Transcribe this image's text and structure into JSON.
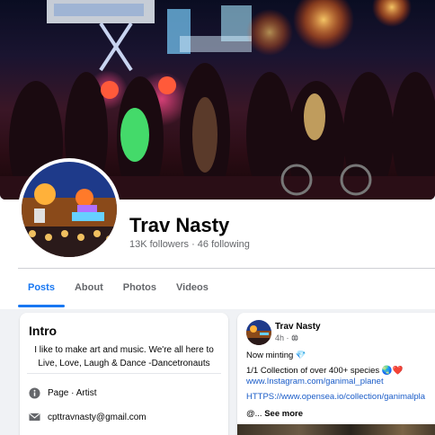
{
  "profile": {
    "name": "Trav Nasty",
    "stats": "13K followers · 46 following"
  },
  "tabs": [
    {
      "label": "Posts",
      "active": true
    },
    {
      "label": "About",
      "active": false
    },
    {
      "label": "Photos",
      "active": false
    },
    {
      "label": "Videos",
      "active": false
    }
  ],
  "intro": {
    "title": "Intro",
    "bio_line1": "I like to make art and music. We're all here to",
    "bio_line2": "Live, Love, Laugh & Dance -Dancetronauts",
    "category": "Page · Artist",
    "email": "cpttravnasty@gmail.com",
    "icons": {
      "category": "info-icon",
      "email": "envelope-icon"
    }
  },
  "post": {
    "author": "Trav Nasty",
    "time": "4h ·",
    "icons": {
      "audience": "globe-icon"
    },
    "line1": "Now minting 💎",
    "line2": "1/1 Collection of over 400+ species 🌏❤️",
    "link1": "www.Instagram.com/ganimal_planet",
    "link2": "HTTPS://www.opensea.io/collection/ganimalpla",
    "line5_prefix": "@...",
    "see_more": "See more"
  },
  "colors": {
    "accent": "#1877f2",
    "link": "#1a5cc8",
    "muted": "#65676b",
    "background": "#f0f2f5"
  }
}
